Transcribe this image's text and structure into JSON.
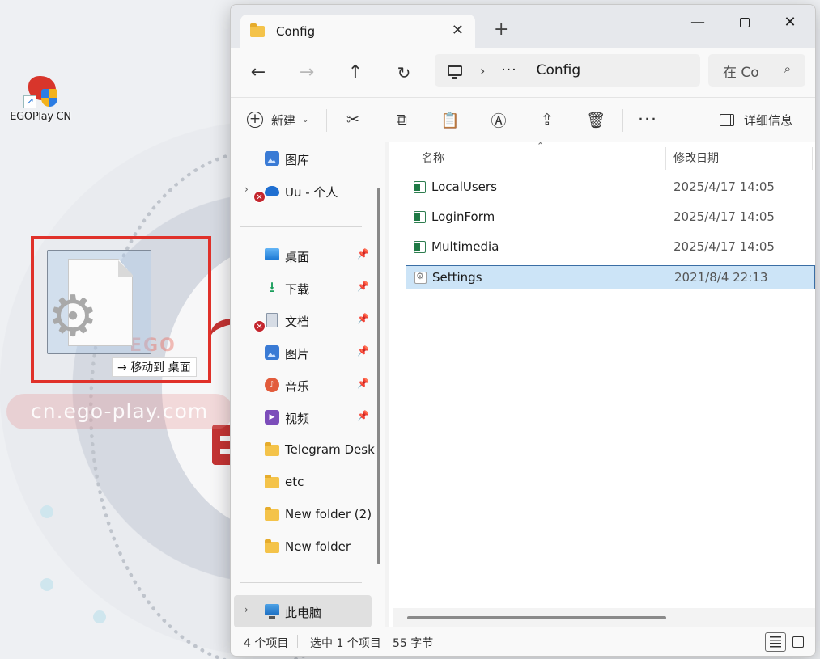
{
  "desktop": {
    "shortcut_label": "EGOPlay CN",
    "drag_tooltip": {
      "arrow": "→",
      "action": "移动到",
      "target": "桌面"
    },
    "watermark_text": "cn.ego-play.com",
    "watermark_logo": "EGO PLAY"
  },
  "window": {
    "tab_title": "Config",
    "tab_close": "✕",
    "new_tab": "+",
    "controls": {
      "minimize": "—",
      "close": "✕"
    }
  },
  "address": {
    "back": "←",
    "forward": "→",
    "up": "↑",
    "refresh": "↻",
    "separator": "›",
    "overflow": "···",
    "path": "Config",
    "search_placeholder": "在 Co",
    "search_icon": "⌕"
  },
  "commandbar": {
    "new_label": "新建",
    "new_caret": "⌄",
    "cut_icon": "✂",
    "copy_icon": "⧉",
    "paste_icon": "📋",
    "rename_icon": "Ⓐ",
    "share_icon": "⇪",
    "delete_icon": "🗑",
    "more": "···",
    "details_label": "详细信息"
  },
  "navpane": {
    "items": [
      {
        "label": "图库",
        "icon": "gallery-icon"
      },
      {
        "label": "Uu - 个人",
        "icon": "onedrive-icon",
        "status": "error"
      },
      {
        "label": "桌面",
        "icon": "desktop-icon",
        "pinned": true
      },
      {
        "label": "下载",
        "icon": "download-icon",
        "pinned": true
      },
      {
        "label": "文档",
        "icon": "documents-icon",
        "pinned": true,
        "status": "error"
      },
      {
        "label": "图片",
        "icon": "pictures-icon",
        "pinned": true
      },
      {
        "label": "音乐",
        "icon": "music-icon",
        "pinned": true
      },
      {
        "label": "视频",
        "icon": "video-icon",
        "pinned": true
      },
      {
        "label": "Telegram Desk",
        "icon": "folder-icon"
      },
      {
        "label": "etc",
        "icon": "folder-icon"
      },
      {
        "label": "New folder (2)",
        "icon": "folder-icon"
      },
      {
        "label": "New folder",
        "icon": "folder-icon"
      },
      {
        "label": "此电脑",
        "icon": "this-pc-icon"
      }
    ],
    "pin_glyph": "📌",
    "expand_glyph": "›",
    "error_glyph": "✕"
  },
  "content": {
    "columns": [
      "名称",
      "修改日期"
    ],
    "sort_indicator": "⌃",
    "files": [
      {
        "name": "LocalUsers",
        "date": "2025/4/17 14:05",
        "type": "excel"
      },
      {
        "name": "LoginForm",
        "date": "2025/4/17 14:05",
        "type": "excel"
      },
      {
        "name": "Multimedia",
        "date": "2025/4/17 14:05",
        "type": "excel"
      },
      {
        "name": "Settings",
        "date": "2021/8/4 22:13",
        "type": "config",
        "selected": true
      }
    ]
  },
  "status": {
    "item_count": "4 个项目",
    "selection": "选中 1 个项目",
    "size": "55 字节"
  },
  "colors": {
    "accent": "#0067c0",
    "selection": "#cce4f7",
    "highlight_box": "#e0312a",
    "error": "#c4262e"
  }
}
